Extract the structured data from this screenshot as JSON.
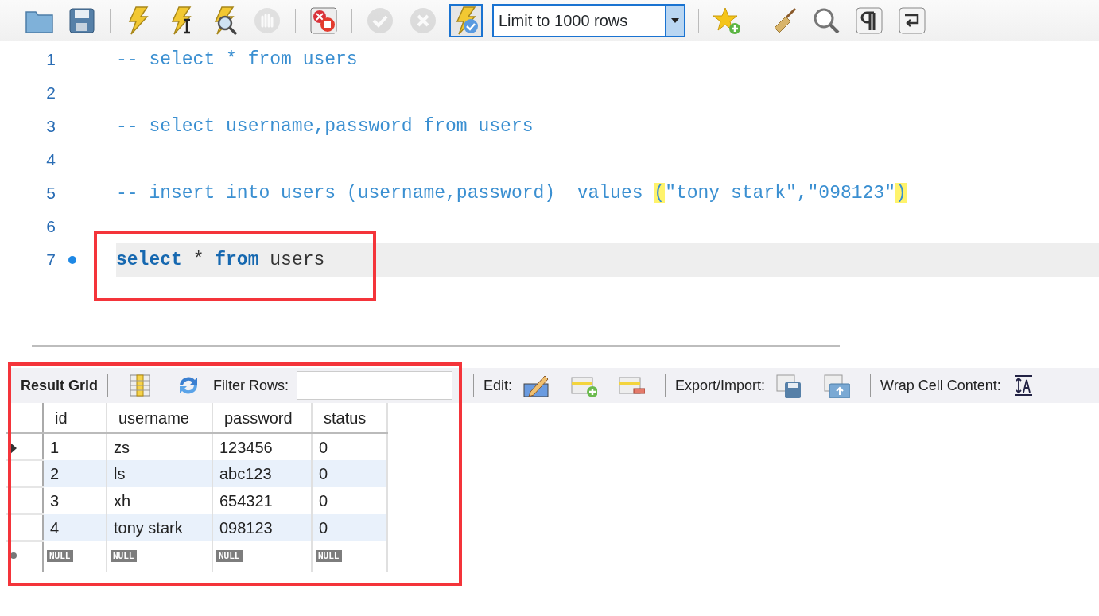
{
  "toolbar": {
    "items": [
      {
        "kind": "folder",
        "disabled": false,
        "pressed": false
      },
      {
        "kind": "save",
        "disabled": false,
        "pressed": false
      },
      {
        "kind": "separator"
      },
      {
        "kind": "execute",
        "disabled": false,
        "pressed": false
      },
      {
        "kind": "execute-current",
        "disabled": false,
        "pressed": false
      },
      {
        "kind": "explain",
        "disabled": false,
        "pressed": false
      },
      {
        "kind": "stop",
        "disabled": true,
        "pressed": false
      },
      {
        "kind": "separator"
      },
      {
        "kind": "stop-on-error",
        "disabled": false,
        "pressed": false
      },
      {
        "kind": "separator"
      },
      {
        "kind": "commit",
        "disabled": true,
        "pressed": false
      },
      {
        "kind": "rollback",
        "disabled": true,
        "pressed": false
      },
      {
        "kind": "autocommit",
        "disabled": false,
        "pressed": true
      },
      {
        "kind": "select",
        "value": "Limit to 1000 rows"
      },
      {
        "kind": "separator"
      },
      {
        "kind": "bookmark",
        "disabled": false,
        "pressed": false
      },
      {
        "kind": "separator"
      },
      {
        "kind": "beautify",
        "disabled": false,
        "pressed": false
      },
      {
        "kind": "find",
        "disabled": false,
        "pressed": false
      },
      {
        "kind": "invisibles",
        "disabled": false,
        "pressed": false
      },
      {
        "kind": "wrap",
        "disabled": false,
        "pressed": false
      }
    ]
  },
  "editor": {
    "lines": [
      {
        "number": "1",
        "current": false,
        "marker": false,
        "annotated": false,
        "tokens": [
          {
            "kind": "comment",
            "text": "-- select * from users"
          }
        ]
      },
      {
        "number": "2",
        "current": false,
        "marker": false,
        "annotated": false
      },
      {
        "number": "3",
        "current": false,
        "marker": false,
        "annotated": false,
        "tokens": [
          {
            "kind": "comment",
            "text": "-- select username,password from users"
          }
        ]
      },
      {
        "number": "4",
        "current": false,
        "marker": false,
        "annotated": false
      },
      {
        "number": "5",
        "current": false,
        "marker": false,
        "annotated": false,
        "tokens": [
          {
            "kind": "comment",
            "text": "-- insert into users (username,password)  values "
          },
          {
            "kind": "bracket",
            "text": "("
          },
          {
            "kind": "comment",
            "text": "\"tony stark\",\"098123\""
          },
          {
            "kind": "bracket",
            "text": ")"
          }
        ]
      },
      {
        "number": "6",
        "current": false,
        "marker": false,
        "annotated": false
      },
      {
        "number": "7",
        "current": true,
        "marker": true,
        "annotated": true,
        "tokens": [
          {
            "kind": "keyword",
            "text": "select"
          },
          {
            "kind": "plain",
            "text": " * "
          },
          {
            "kind": "keyword",
            "text": "from"
          },
          {
            "kind": "plain",
            "text": " users"
          }
        ]
      }
    ]
  },
  "result_grid": {
    "annotated": true,
    "toolbar": [
      {
        "kind": "title",
        "text": "Result Grid"
      },
      {
        "kind": "separator"
      },
      {
        "kind": "grid-columns"
      },
      {
        "kind": "refresh"
      },
      {
        "kind": "label",
        "text": "Filter Rows:"
      },
      {
        "kind": "field"
      },
      {
        "kind": "separator"
      },
      {
        "kind": "label",
        "text": "Edit:"
      },
      {
        "kind": "edit"
      },
      {
        "kind": "add-row"
      },
      {
        "kind": "delete-row"
      },
      {
        "kind": "separator"
      },
      {
        "kind": "label",
        "text": "Export/Import:"
      },
      {
        "kind": "export"
      },
      {
        "kind": "import"
      },
      {
        "kind": "separator"
      },
      {
        "kind": "label",
        "text": "Wrap Cell Content:"
      },
      {
        "kind": "wrap-cell"
      }
    ],
    "columns": [
      "id",
      "username",
      "password",
      "status"
    ],
    "rows": [
      {
        "current": true,
        "cells": [
          "1",
          "zs",
          "123456",
          "0"
        ]
      },
      {
        "current": false,
        "cells": [
          "2",
          "ls",
          "abc123",
          "0"
        ]
      },
      {
        "current": false,
        "cells": [
          "3",
          "xh",
          "654321",
          "0"
        ]
      },
      {
        "current": false,
        "cells": [
          "4",
          "tony stark",
          "098123",
          "0"
        ]
      }
    ],
    "new_row": [
      "NULL",
      "NULL",
      "NULL",
      "NULL"
    ]
  }
}
